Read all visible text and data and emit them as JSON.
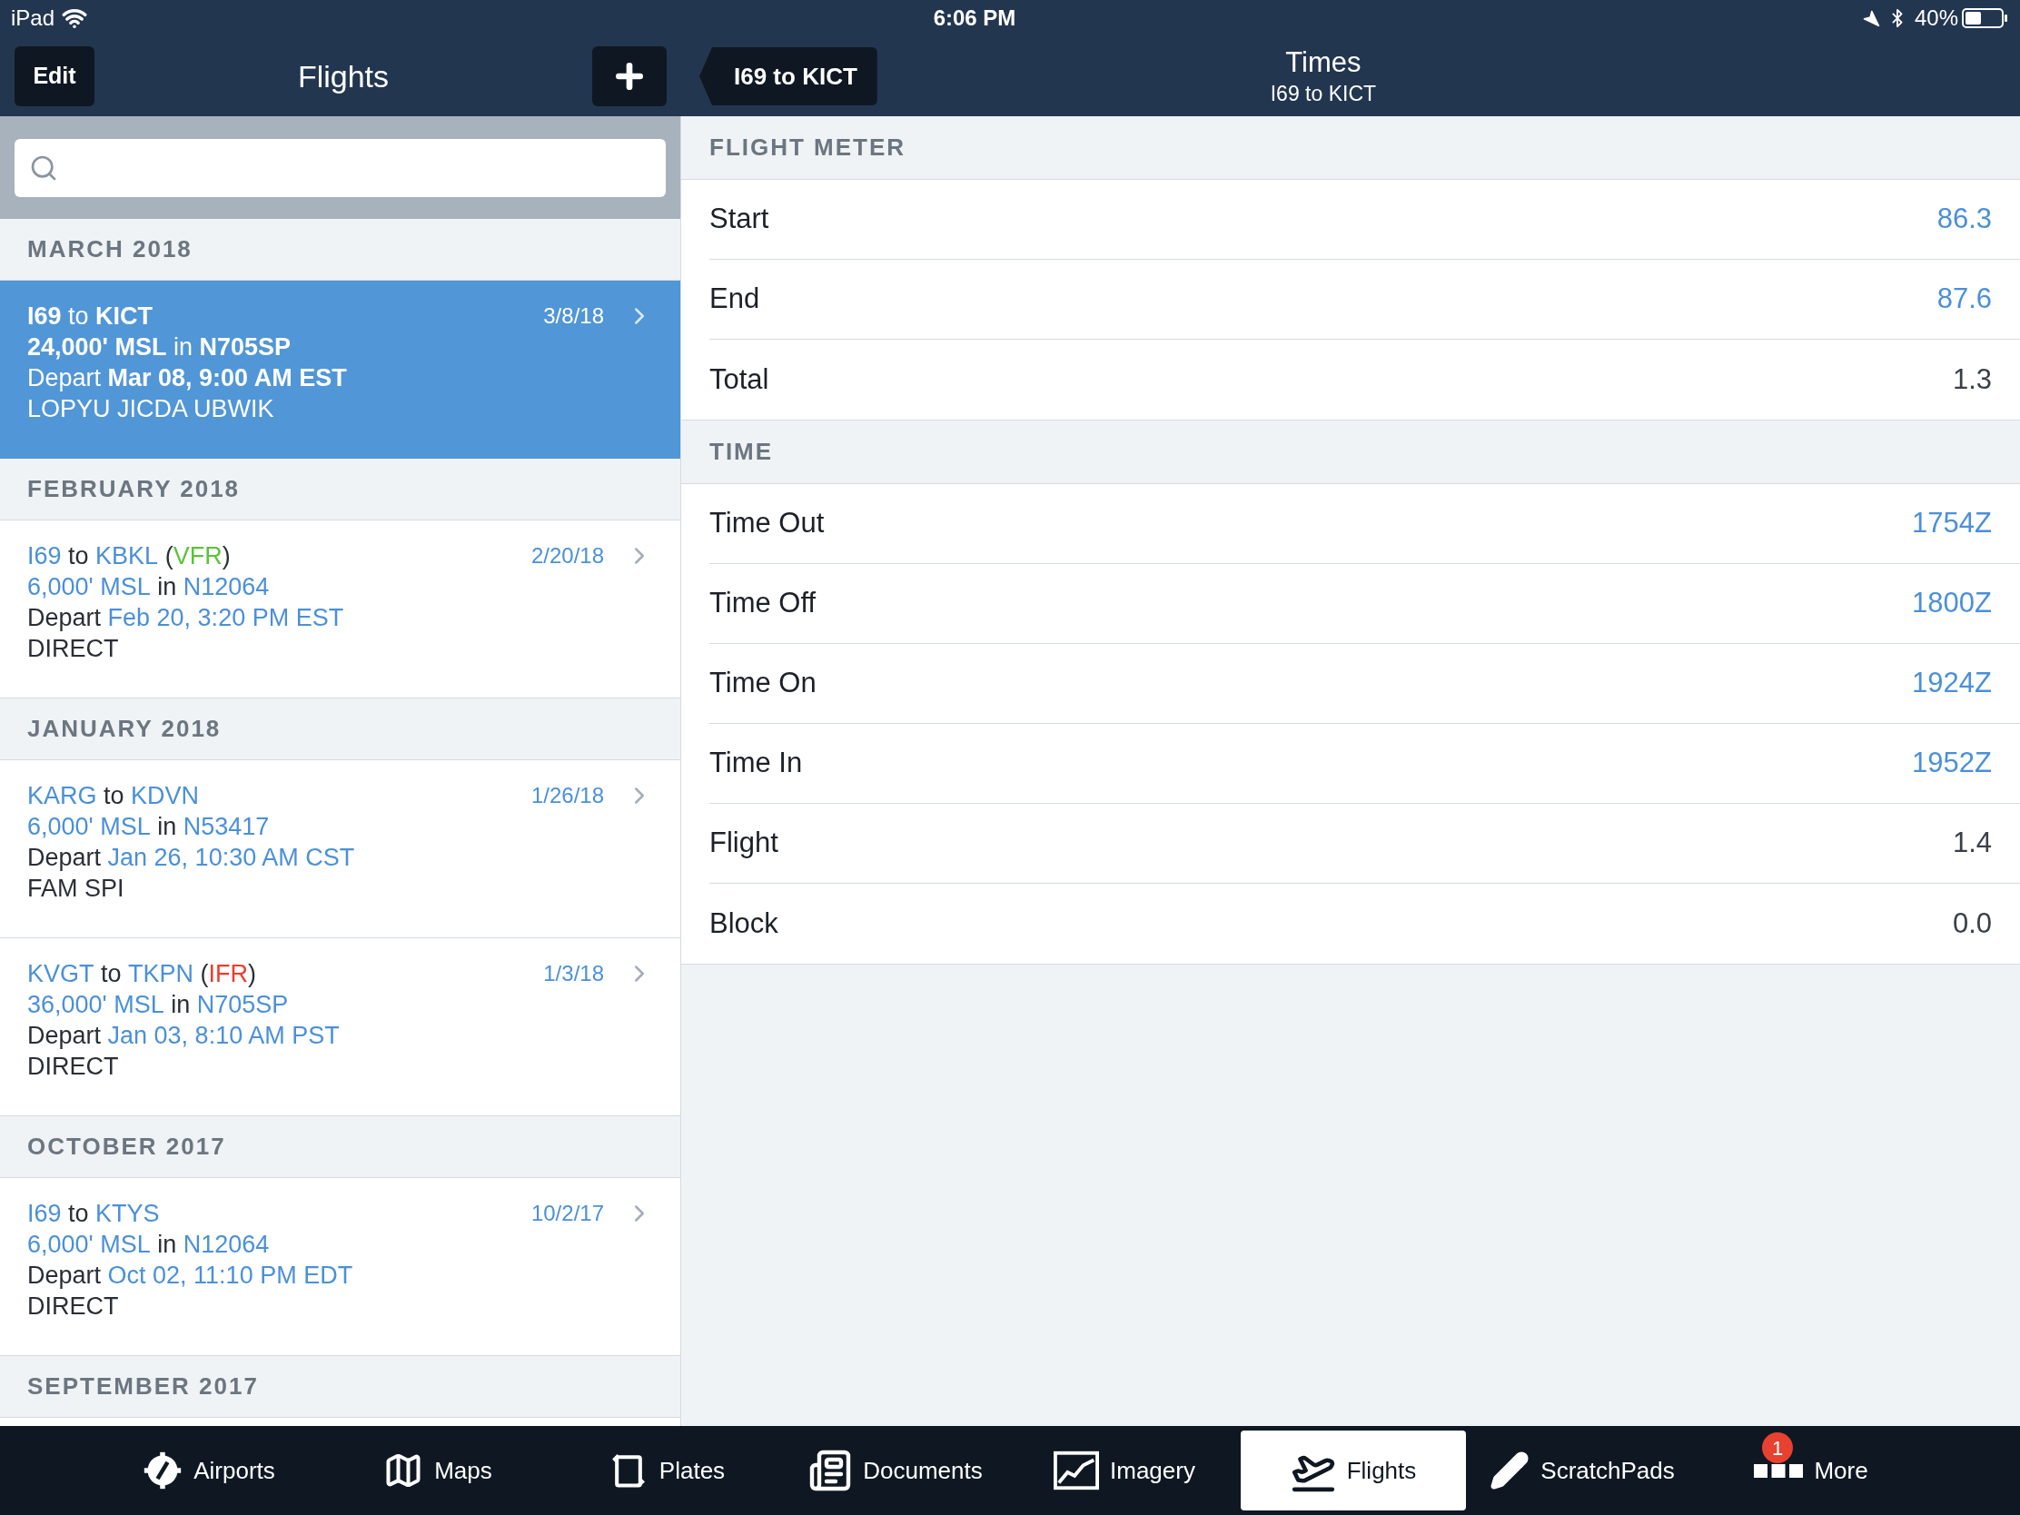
{
  "status_bar": {
    "device": "iPad",
    "time": "6:06 PM",
    "battery": "40%"
  },
  "left_nav": {
    "edit": "Edit",
    "title": "Flights"
  },
  "right_nav": {
    "back": "I69 to KICT",
    "title": "Times",
    "subtitle": "I69 to KICT"
  },
  "flight_groups": [
    {
      "header": "MARCH 2018",
      "flights": [
        {
          "selected": true,
          "date": "3/8/18",
          "lines": [
            [
              {
                "text": "I69",
                "kind": "value"
              },
              {
                "text": " to ",
                "kind": "plain"
              },
              {
                "text": "KICT",
                "kind": "value"
              }
            ],
            [
              {
                "text": "24,000' MSL",
                "kind": "value"
              },
              {
                "text": " in ",
                "kind": "plain"
              },
              {
                "text": "N705SP",
                "kind": "value"
              }
            ],
            [
              {
                "text": "Depart ",
                "kind": "plain"
              },
              {
                "text": "Mar 08, 9:00 AM EST",
                "kind": "value"
              }
            ],
            [
              {
                "text": "LOPYU JICDA UBWIK",
                "kind": "plain"
              }
            ]
          ]
        }
      ]
    },
    {
      "header": "FEBRUARY 2018",
      "flights": [
        {
          "selected": false,
          "date": "2/20/18",
          "lines": [
            [
              {
                "text": "I69",
                "kind": "value"
              },
              {
                "text": " to ",
                "kind": "plain"
              },
              {
                "text": "KBKL",
                "kind": "value"
              },
              {
                "text": " (",
                "kind": "plain"
              },
              {
                "text": "VFR",
                "kind": "vfr"
              },
              {
                "text": ")",
                "kind": "plain"
              }
            ],
            [
              {
                "text": "6,000' MSL",
                "kind": "value"
              },
              {
                "text": " in ",
                "kind": "plain"
              },
              {
                "text": "N12064",
                "kind": "value"
              }
            ],
            [
              {
                "text": "Depart ",
                "kind": "plain"
              },
              {
                "text": "Feb 20, 3:20 PM EST",
                "kind": "value"
              }
            ],
            [
              {
                "text": "DIRECT",
                "kind": "plain"
              }
            ]
          ]
        }
      ]
    },
    {
      "header": "JANUARY 2018",
      "flights": [
        {
          "selected": false,
          "date": "1/26/18",
          "lines": [
            [
              {
                "text": "KARG",
                "kind": "value"
              },
              {
                "text": " to ",
                "kind": "plain"
              },
              {
                "text": "KDVN",
                "kind": "value"
              }
            ],
            [
              {
                "text": "6,000' MSL",
                "kind": "value"
              },
              {
                "text": " in ",
                "kind": "plain"
              },
              {
                "text": "N53417",
                "kind": "value"
              }
            ],
            [
              {
                "text": "Depart ",
                "kind": "plain"
              },
              {
                "text": "Jan 26, 10:30 AM CST",
                "kind": "value"
              }
            ],
            [
              {
                "text": "FAM SPI",
                "kind": "plain"
              }
            ]
          ]
        },
        {
          "selected": false,
          "date": "1/3/18",
          "lines": [
            [
              {
                "text": "KVGT",
                "kind": "value"
              },
              {
                "text": " to ",
                "kind": "plain"
              },
              {
                "text": "TKPN",
                "kind": "value"
              },
              {
                "text": " (",
                "kind": "plain"
              },
              {
                "text": "IFR",
                "kind": "ifr"
              },
              {
                "text": ")",
                "kind": "plain"
              }
            ],
            [
              {
                "text": "36,000' MSL",
                "kind": "value"
              },
              {
                "text": " in ",
                "kind": "plain"
              },
              {
                "text": "N705SP",
                "kind": "value"
              }
            ],
            [
              {
                "text": "Depart ",
                "kind": "plain"
              },
              {
                "text": "Jan 03, 8:10 AM PST",
                "kind": "value"
              }
            ],
            [
              {
                "text": "DIRECT",
                "kind": "plain"
              }
            ]
          ]
        }
      ]
    },
    {
      "header": "OCTOBER 2017",
      "flights": [
        {
          "selected": false,
          "date": "10/2/17",
          "lines": [
            [
              {
                "text": "I69",
                "kind": "value"
              },
              {
                "text": " to ",
                "kind": "plain"
              },
              {
                "text": "KTYS",
                "kind": "value"
              }
            ],
            [
              {
                "text": "6,000' MSL",
                "kind": "value"
              },
              {
                "text": " in ",
                "kind": "plain"
              },
              {
                "text": "N12064",
                "kind": "value"
              }
            ],
            [
              {
                "text": "Depart ",
                "kind": "plain"
              },
              {
                "text": "Oct 02, 11:10 PM EDT",
                "kind": "value"
              }
            ],
            [
              {
                "text": "DIRECT",
                "kind": "plain"
              }
            ]
          ]
        }
      ]
    },
    {
      "header": "SEPTEMBER 2017"
    }
  ],
  "sections": [
    {
      "header": "FLIGHT METER",
      "rows": [
        {
          "label": "Start",
          "value": "86.3",
          "kind": "editable"
        },
        {
          "label": "End",
          "value": "87.6",
          "kind": "editable"
        },
        {
          "label": "Total",
          "value": "1.3",
          "kind": "computed"
        }
      ]
    },
    {
      "header": "TIME",
      "rows": [
        {
          "label": "Time Out",
          "value": "1754Z",
          "kind": "editable"
        },
        {
          "label": "Time Off",
          "value": "1800Z",
          "kind": "editable"
        },
        {
          "label": "Time On",
          "value": "1924Z",
          "kind": "editable"
        },
        {
          "label": "Time In",
          "value": "1952Z",
          "kind": "editable"
        },
        {
          "label": "Flight",
          "value": "1.4",
          "kind": "computed"
        },
        {
          "label": "Block",
          "value": "0.0",
          "kind": "computed"
        }
      ]
    }
  ],
  "tab_bar": [
    {
      "label": "Airports",
      "kind": "airports",
      "selected": false
    },
    {
      "label": "Maps",
      "kind": "maps",
      "selected": false
    },
    {
      "label": "Plates",
      "kind": "plates",
      "selected": false
    },
    {
      "label": "Documents",
      "kind": "documents",
      "selected": false
    },
    {
      "label": "Imagery",
      "kind": "imagery",
      "selected": false
    },
    {
      "label": "Flights",
      "kind": "flights",
      "selected": true
    },
    {
      "label": "ScratchPads",
      "kind": "scratchpads",
      "selected": false
    },
    {
      "label": "More",
      "kind": "more",
      "selected": false,
      "badge": "1"
    }
  ]
}
